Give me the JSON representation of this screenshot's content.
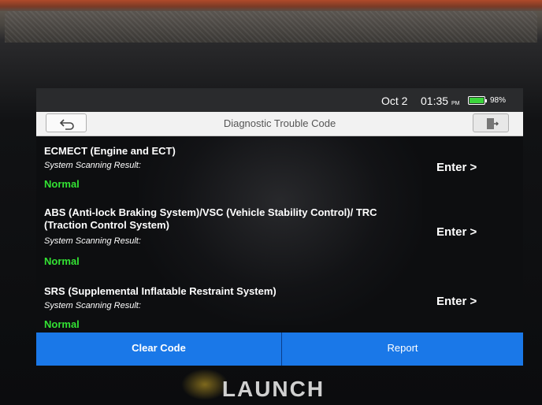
{
  "status_bar": {
    "date": "Oct 2",
    "time": "01:35",
    "ampm": "PM",
    "battery_percent": "98%",
    "battery_level": 0.98,
    "battery_color": "#3cd43c"
  },
  "header": {
    "title": "Diagnostic Trouble Code",
    "back_icon": "back-arrow-icon",
    "exit_icon": "exit-door-icon"
  },
  "systems": [
    {
      "name": "ECMECT (Engine and ECT)",
      "scan_label": "System Scanning Result:",
      "result": "Normal",
      "enter_label": "Enter >"
    },
    {
      "name": "ABS (Anti-lock Braking System)/VSC (Vehicle Stability Control)/ TRC (Traction Control System)",
      "scan_label": "System Scanning Result:",
      "result": "Normal",
      "enter_label": "Enter >"
    },
    {
      "name": "SRS (Supplemental Inflatable Restraint System)",
      "scan_label": "System Scanning Result:",
      "result": "Normal",
      "enter_label": "Enter >"
    }
  ],
  "footer": {
    "clear_code_label": "Clear Code",
    "report_label": "Report"
  },
  "device": {
    "brand": "LAUNCH"
  },
  "colors": {
    "accent": "#1a78e8",
    "normal_status": "#33e233"
  }
}
